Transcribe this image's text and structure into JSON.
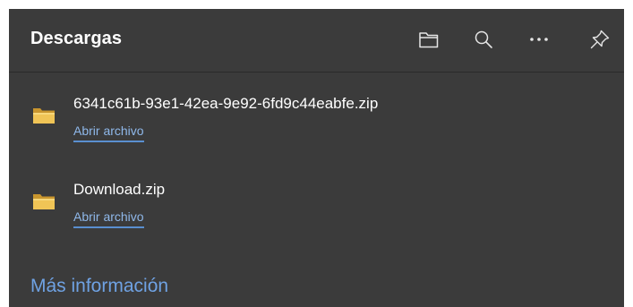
{
  "panel": {
    "title": "Descargas",
    "header_icons": [
      "folder-icon",
      "search-icon",
      "more-options-icon",
      "pin-icon"
    ]
  },
  "downloads": [
    {
      "file_name": "6341c61b-93e1-42ea-9e92-6fd9c44eabfe.zip",
      "action_label": "Abrir archivo",
      "icon": "folder-icon"
    },
    {
      "file_name": "Download.zip",
      "action_label": "Abrir archivo",
      "icon": "folder-icon"
    }
  ],
  "footer": {
    "more_info_label": "Más información"
  },
  "colors": {
    "panel_background": "#3b3b3b",
    "link": "#8fb8ea",
    "folder": "#e8b84a"
  }
}
